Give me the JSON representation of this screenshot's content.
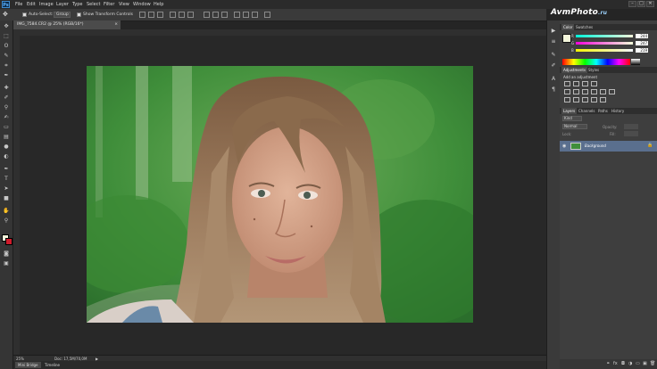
{
  "app": {
    "logo_text": "Ps"
  },
  "menu": [
    "File",
    "Edit",
    "Image",
    "Layer",
    "Type",
    "Select",
    "Filter",
    "View",
    "Window",
    "Help"
  ],
  "window_controls": {
    "minimize": "–",
    "maximize": "□",
    "close": "✕"
  },
  "watermark": {
    "brand": "AvmPhoto",
    "tld": ".ru"
  },
  "options_bar": {
    "auto_select_label": "Auto-Select:",
    "auto_select_value": "Group",
    "show_transform_label": "Show Transform Controls"
  },
  "document": {
    "tab_title": "IMG_7584.CR2 @ 25% (RGB/16*)",
    "close_glyph": "×"
  },
  "status_bar": {
    "zoom": "25%",
    "doc_size": "Doc: 17,5M/70,0M",
    "arrow": "▶"
  },
  "bottom_tabs": [
    "Mini Bridge",
    "Timeline"
  ],
  "color_panel": {
    "tabs": [
      "Color",
      "Swatches"
    ],
    "channels": [
      {
        "label": "R",
        "value": "244"
      },
      {
        "label": "G",
        "value": "247"
      },
      {
        "label": "B",
        "value": "219"
      }
    ],
    "foreground_color": "#f4f7db",
    "background_color": "#d01c2c"
  },
  "adjustments_panel": {
    "tabs": [
      "Adjustments",
      "Styles"
    ],
    "header": "Add an adjustment"
  },
  "layers_panel": {
    "tabs": [
      "Layers",
      "Channels",
      "Paths",
      "History"
    ],
    "kind_label": "Kind",
    "blend_mode": "Normal",
    "opacity_label": "Opacity:",
    "lock_label": "Lock:",
    "fill_label": "Fill:",
    "layer_name": "Background"
  },
  "colors": {
    "selected_layer": "#5a6f8e",
    "panel_bg": "#3e3e3e",
    "workspace": "#282828"
  }
}
